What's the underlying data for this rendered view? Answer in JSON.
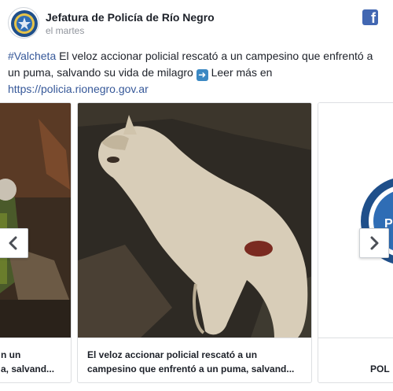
{
  "post": {
    "page_name": "Jefatura de Policía de Río Negro",
    "timestamp": "el martes",
    "hashtag": "#Valcheta",
    "body_text": " El veloz accionar policial rescató a un campesino que enfrentó a un puma, salvando su vida de milagro ",
    "read_more": " Leer más en ",
    "link": "https://policia.rionegro.gov.ar"
  },
  "carousel": {
    "cards": [
      {
        "caption_line1": "n un",
        "caption_line2": "a, salvand..."
      },
      {
        "caption_line1": "El veloz accionar policial rescató a un",
        "caption_line2": "campesino que enfrentó a un puma, salvand..."
      },
      {
        "caption": "POL"
      }
    ]
  },
  "icons": {
    "facebook": "facebook-logo-icon",
    "prev": "chevron-left-icon",
    "next": "chevron-right-icon",
    "arrow": "right-arrow-emoji-icon"
  },
  "colors": {
    "link": "#365899",
    "facebook_blue": "#4267b2",
    "text": "#1d2129",
    "meta": "#90949c"
  }
}
